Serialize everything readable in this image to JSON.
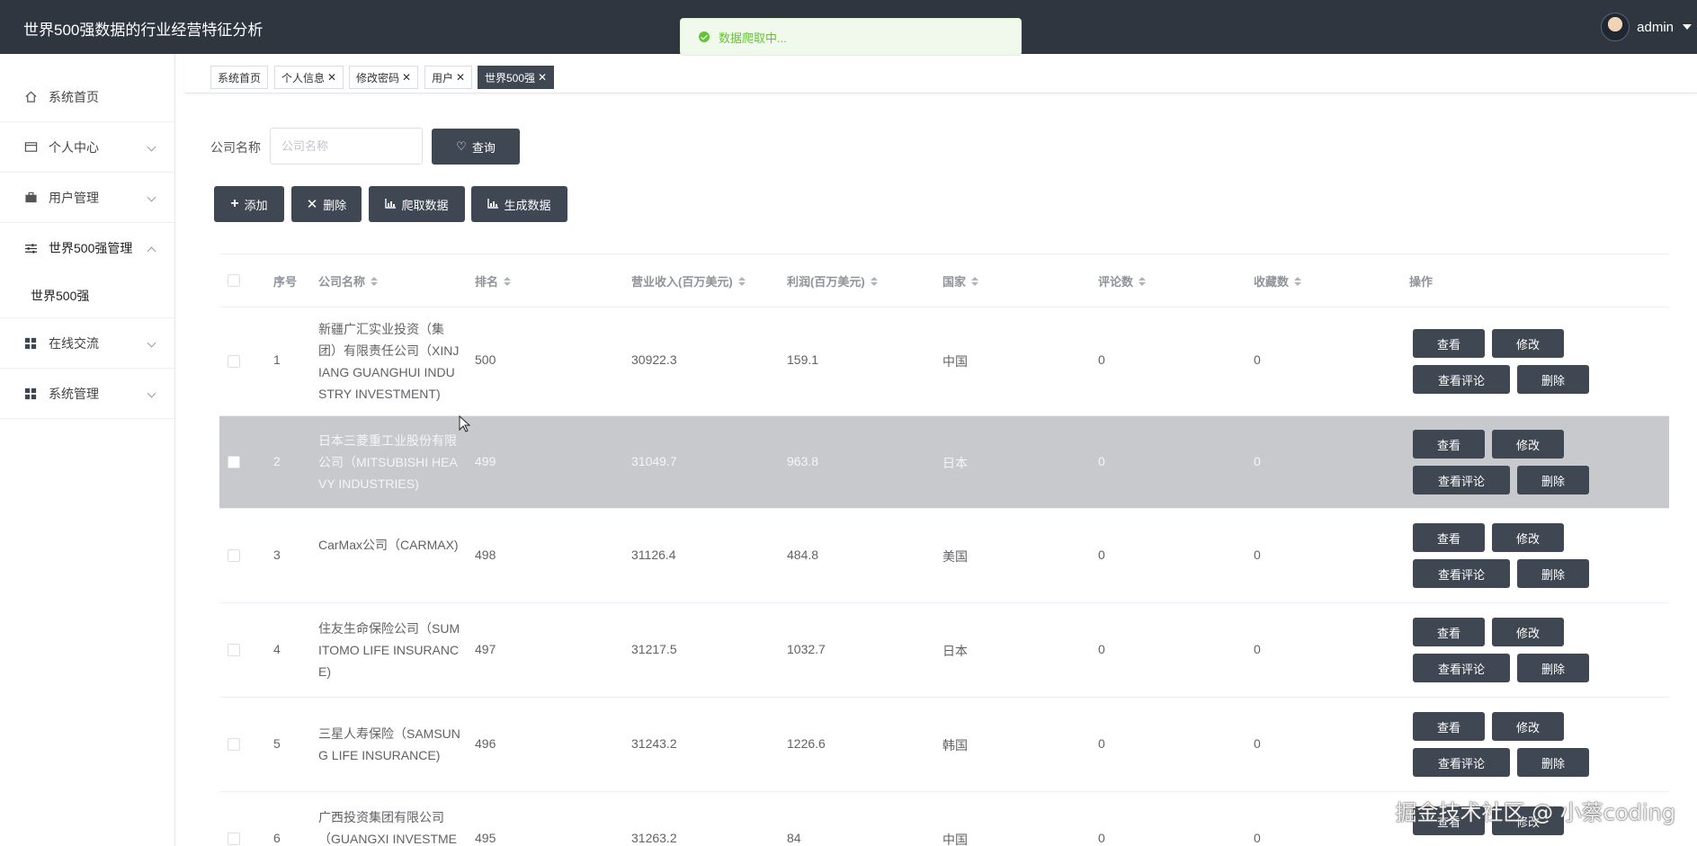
{
  "app": {
    "title": "世界500强数据的行业经营特征分析",
    "user": "admin"
  },
  "toast": {
    "message": "数据爬取中..."
  },
  "sidebar": {
    "items": [
      {
        "label": "系统首页",
        "icon": "home-icon"
      },
      {
        "label": "个人中心",
        "icon": "card-icon"
      },
      {
        "label": "用户管理",
        "icon": "briefcase-icon"
      },
      {
        "label": "世界500强管理",
        "icon": "sliders-icon"
      },
      {
        "label": "在线交流",
        "icon": "grid-icon"
      },
      {
        "label": "系统管理",
        "icon": "grid-icon"
      }
    ],
    "submenu": {
      "label": "世界500强"
    }
  },
  "tabs": [
    {
      "label": "系统首页",
      "closable": false
    },
    {
      "label": "个人信息",
      "closable": true
    },
    {
      "label": "修改密码",
      "closable": true
    },
    {
      "label": "用户",
      "closable": true
    },
    {
      "label": "世界500强",
      "closable": true,
      "active": true
    }
  ],
  "search": {
    "label": "公司名称",
    "placeholder": "公司名称",
    "button": "查询"
  },
  "toolbar": {
    "add": "添加",
    "delete": "删除",
    "crawl": "爬取数据",
    "generate": "生成数据"
  },
  "table": {
    "headers": [
      "序号",
      "公司名称",
      "排名",
      "营业收入(百万美元)",
      "利润(百万美元)",
      "国家",
      "评论数",
      "收藏数",
      "操作"
    ],
    "rows": [
      {
        "no": "1",
        "name": "新疆广汇实业投资（集团）有限责任公司（XINJIANG GUANGHUI INDUSTRY INVESTMENT)",
        "rank": "500",
        "revenue": "30922.3",
        "profit": "159.1",
        "country": "中国",
        "comments": "0",
        "favorites": "0"
      },
      {
        "no": "2",
        "name": "日本三菱重工业股份有限公司（MITSUBISHI HEAVY INDUSTRIES)",
        "rank": "499",
        "revenue": "31049.7",
        "profit": "963.8",
        "country": "日本",
        "comments": "0",
        "favorites": "0"
      },
      {
        "no": "3",
        "name": "CarMax公司（CARMAX)",
        "rank": "498",
        "revenue": "31126.4",
        "profit": "484.8",
        "country": "美国",
        "comments": "0",
        "favorites": "0"
      },
      {
        "no": "4",
        "name": "住友生命保险公司（SUMITOMO LIFE INSURANCE)",
        "rank": "497",
        "revenue": "31217.5",
        "profit": "1032.7",
        "country": "日本",
        "comments": "0",
        "favorites": "0"
      },
      {
        "no": "5",
        "name": "三星人寿保险（SAMSUNG LIFE INSURANCE)",
        "rank": "496",
        "revenue": "31243.2",
        "profit": "1226.6",
        "country": "韩国",
        "comments": "0",
        "favorites": "0"
      },
      {
        "no": "6",
        "name": "广西投资集团有限公司（GUANGXI INVESTME",
        "rank": "495",
        "revenue": "31263.2",
        "profit": "84",
        "country": "中国",
        "comments": "0",
        "favorites": "0"
      }
    ],
    "actions": {
      "view": "查看",
      "edit": "修改",
      "view_comments": "查看评论",
      "delete": "删除"
    }
  },
  "watermark": "掘金技术社区 @ 小蔡coding"
}
